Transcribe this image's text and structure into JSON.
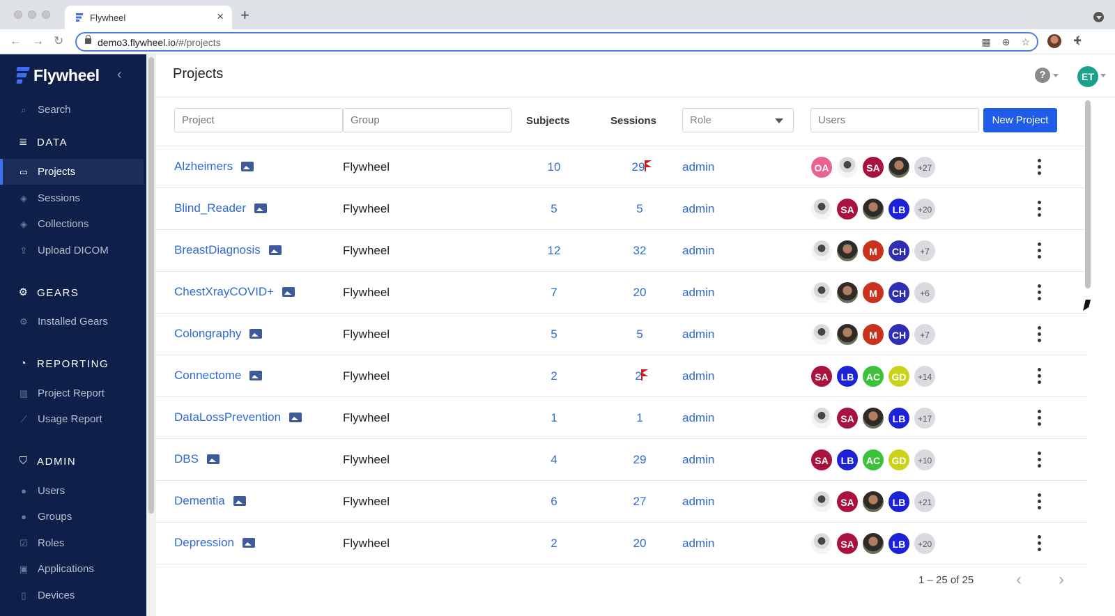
{
  "browser": {
    "tab_title": "Flywheel",
    "url_domain": "demo3.flywheel.io",
    "url_path": "/#/projects"
  },
  "sidebar": {
    "brand": "Flywheel",
    "search_label": "Search",
    "sections": [
      {
        "title": "DATA",
        "icon": "database-icon",
        "items": [
          {
            "label": "Projects",
            "icon": "folder-open-icon",
            "active": true
          },
          {
            "label": "Sessions",
            "icon": "cube-icon"
          },
          {
            "label": "Collections",
            "icon": "cubes-icon"
          },
          {
            "label": "Upload DICOM",
            "icon": "upload-icon"
          }
        ]
      },
      {
        "title": "GEARS",
        "icon": "gear-icon",
        "items": [
          {
            "label": "Installed Gears",
            "icon": "gear-icon"
          }
        ]
      },
      {
        "title": "REPORTING",
        "icon": "pie-chart-icon",
        "items": [
          {
            "label": "Project Report",
            "icon": "bar-chart-icon"
          },
          {
            "label": "Usage Report",
            "icon": "line-chart-icon"
          }
        ]
      },
      {
        "title": "ADMIN",
        "icon": "shield-icon",
        "items": [
          {
            "label": "Users",
            "icon": "user-icon"
          },
          {
            "label": "Groups",
            "icon": "users-icon"
          },
          {
            "label": "Roles",
            "icon": "check-square-icon"
          },
          {
            "label": "Applications",
            "icon": "window-icon"
          },
          {
            "label": "Devices",
            "icon": "device-icon"
          }
        ]
      }
    ]
  },
  "header": {
    "title": "Projects",
    "help_symbol": "?",
    "user_initials": "ET"
  },
  "filters": {
    "project_placeholder": "Project",
    "group_placeholder": "Group",
    "subjects_header": "Subjects",
    "sessions_header": "Sessions",
    "role_placeholder": "Role",
    "users_placeholder": "Users",
    "new_project_label": "New Project"
  },
  "colors": {
    "accent": "#1f5de8",
    "link": "#2f6ad3",
    "sidebar_bg": "#0e2049",
    "flag": "#cc1b1b"
  },
  "projects": [
    {
      "name": "Alzheimers",
      "group": "Flywheel",
      "subjects": "10",
      "sessions": "29",
      "flagged": true,
      "role": "admin",
      "users": [
        {
          "t": "OA",
          "c": "#e8638f"
        },
        {
          "t": "",
          "c": "photo1"
        },
        {
          "t": "SA",
          "c": "#a8123c"
        },
        {
          "t": "",
          "c": "photo2"
        }
      ],
      "more": "+27"
    },
    {
      "name": "Blind_Reader",
      "group": "Flywheel",
      "subjects": "5",
      "sessions": "5",
      "flagged": false,
      "role": "admin",
      "users": [
        {
          "t": "",
          "c": "photo1"
        },
        {
          "t": "SA",
          "c": "#a8123c"
        },
        {
          "t": "",
          "c": "photo2"
        },
        {
          "t": "LB",
          "c": "#1c22d8"
        }
      ],
      "more": "+20"
    },
    {
      "name": "BreastDiagnosis",
      "group": "Flywheel",
      "subjects": "12",
      "sessions": "32",
      "flagged": false,
      "role": "admin",
      "users": [
        {
          "t": "",
          "c": "photo1"
        },
        {
          "t": "",
          "c": "photo2"
        },
        {
          "t": "M",
          "c": "#c8321f"
        },
        {
          "t": "CH",
          "c": "#2e2fb5"
        }
      ],
      "more": "+7"
    },
    {
      "name": "ChestXrayCOVID+",
      "group": "Flywheel",
      "subjects": "7",
      "sessions": "20",
      "flagged": false,
      "role": "admin",
      "users": [
        {
          "t": "",
          "c": "photo1"
        },
        {
          "t": "",
          "c": "photo2"
        },
        {
          "t": "M",
          "c": "#c8321f"
        },
        {
          "t": "CH",
          "c": "#2e2fb5"
        }
      ],
      "more": "+6"
    },
    {
      "name": "Colongraphy",
      "group": "Flywheel",
      "subjects": "5",
      "sessions": "5",
      "flagged": false,
      "role": "admin",
      "users": [
        {
          "t": "",
          "c": "photo1"
        },
        {
          "t": "",
          "c": "photo2"
        },
        {
          "t": "M",
          "c": "#c8321f"
        },
        {
          "t": "CH",
          "c": "#2e2fb5"
        }
      ],
      "more": "+7"
    },
    {
      "name": "Connectome",
      "group": "Flywheel",
      "subjects": "2",
      "sessions": "2",
      "flagged": true,
      "role": "admin",
      "users": [
        {
          "t": "SA",
          "c": "#a8123c"
        },
        {
          "t": "LB",
          "c": "#1c22d8"
        },
        {
          "t": "AC",
          "c": "#3cc13a"
        },
        {
          "t": "GD",
          "c": "#c9d318"
        }
      ],
      "more": "+14"
    },
    {
      "name": "DataLossPrevention",
      "group": "Flywheel",
      "subjects": "1",
      "sessions": "1",
      "flagged": false,
      "role": "admin",
      "users": [
        {
          "t": "",
          "c": "photo1"
        },
        {
          "t": "SA",
          "c": "#a8123c"
        },
        {
          "t": "",
          "c": "photo2"
        },
        {
          "t": "LB",
          "c": "#1c22d8"
        }
      ],
      "more": "+17"
    },
    {
      "name": "DBS",
      "group": "Flywheel",
      "subjects": "4",
      "sessions": "29",
      "flagged": false,
      "role": "admin",
      "users": [
        {
          "t": "SA",
          "c": "#a8123c"
        },
        {
          "t": "LB",
          "c": "#1c22d8"
        },
        {
          "t": "AC",
          "c": "#3cc13a"
        },
        {
          "t": "GD",
          "c": "#c9d318"
        }
      ],
      "more": "+10"
    },
    {
      "name": "Dementia",
      "group": "Flywheel",
      "subjects": "6",
      "sessions": "27",
      "flagged": false,
      "role": "admin",
      "users": [
        {
          "t": "",
          "c": "photo1"
        },
        {
          "t": "SA",
          "c": "#a8123c"
        },
        {
          "t": "",
          "c": "photo2"
        },
        {
          "t": "LB",
          "c": "#1c22d8"
        }
      ],
      "more": "+21"
    },
    {
      "name": "Depression",
      "group": "Flywheel",
      "subjects": "2",
      "sessions": "20",
      "flagged": false,
      "role": "admin",
      "users": [
        {
          "t": "",
          "c": "photo1"
        },
        {
          "t": "SA",
          "c": "#a8123c"
        },
        {
          "t": "",
          "c": "photo2"
        },
        {
          "t": "LB",
          "c": "#1c22d8"
        }
      ],
      "more": "+20"
    }
  ],
  "pagination": {
    "range_text": "1 – 25 of 25"
  }
}
